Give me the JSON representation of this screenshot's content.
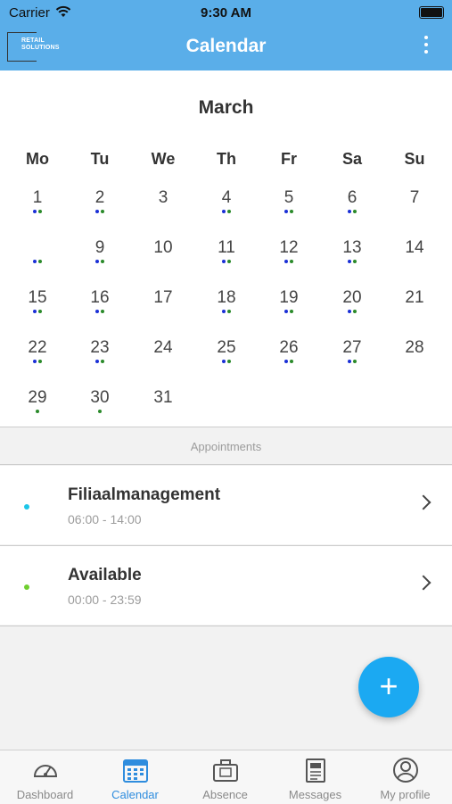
{
  "status_bar": {
    "carrier": "Carrier",
    "time": "9:30 AM"
  },
  "header": {
    "title": "Calendar",
    "logo_line1": "RETAIL",
    "logo_line2": "SOLUTIONS"
  },
  "calendar": {
    "month": "March",
    "weekdays": [
      "Mo",
      "Tu",
      "We",
      "Th",
      "Fr",
      "Sa",
      "Su"
    ],
    "days": [
      {
        "label": "1",
        "dots": [
          "blue",
          "green"
        ]
      },
      {
        "label": "2",
        "dots": [
          "blue",
          "green"
        ]
      },
      {
        "label": "3",
        "dots": []
      },
      {
        "label": "4",
        "dots": [
          "blue",
          "green"
        ]
      },
      {
        "label": "5",
        "dots": [
          "blue",
          "green"
        ]
      },
      {
        "label": "6",
        "dots": [
          "blue",
          "green"
        ]
      },
      {
        "label": "7",
        "dots": []
      },
      {
        "label": "",
        "dots": [
          "blue",
          "green"
        ]
      },
      {
        "label": "9",
        "dots": [
          "blue",
          "green"
        ]
      },
      {
        "label": "10",
        "dots": []
      },
      {
        "label": "11",
        "dots": [
          "blue",
          "green"
        ]
      },
      {
        "label": "12",
        "dots": [
          "blue",
          "green"
        ]
      },
      {
        "label": "13",
        "dots": [
          "blue",
          "green"
        ]
      },
      {
        "label": "14",
        "dots": []
      },
      {
        "label": "15",
        "dots": [
          "blue",
          "green"
        ]
      },
      {
        "label": "16",
        "dots": [
          "blue",
          "green"
        ]
      },
      {
        "label": "17",
        "dots": []
      },
      {
        "label": "18",
        "dots": [
          "blue",
          "green"
        ]
      },
      {
        "label": "19",
        "dots": [
          "blue",
          "green"
        ]
      },
      {
        "label": "20",
        "dots": [
          "blue",
          "green"
        ]
      },
      {
        "label": "21",
        "dots": []
      },
      {
        "label": "22",
        "dots": [
          "blue",
          "green"
        ]
      },
      {
        "label": "23",
        "dots": [
          "blue",
          "green"
        ]
      },
      {
        "label": "24",
        "dots": []
      },
      {
        "label": "25",
        "dots": [
          "blue",
          "green"
        ]
      },
      {
        "label": "26",
        "dots": [
          "blue",
          "green"
        ]
      },
      {
        "label": "27",
        "dots": [
          "blue",
          "green"
        ]
      },
      {
        "label": "28",
        "dots": []
      },
      {
        "label": "29",
        "dots": [
          "green"
        ]
      },
      {
        "label": "30",
        "dots": [
          "green"
        ]
      },
      {
        "label": "31",
        "dots": []
      }
    ],
    "dot_colors": {
      "blue": "#1a2fd6",
      "green": "#2a8a2a"
    }
  },
  "appointments": {
    "section_label": "Appointments",
    "items": [
      {
        "name": "Filiaalmanagement",
        "time": "06:00 - 14:00",
        "color": "#1cc6e8"
      },
      {
        "name": "Available",
        "time": "00:00 - 23:59",
        "color": "#6fcf2f"
      }
    ]
  },
  "fab": {
    "label": "+"
  },
  "tabs": [
    {
      "label": "Dashboard",
      "icon": "gauge-icon"
    },
    {
      "label": "Calendar",
      "icon": "calendar-icon",
      "active": true
    },
    {
      "label": "Absence",
      "icon": "suitcase-icon"
    },
    {
      "label": "Messages",
      "icon": "newspaper-icon"
    },
    {
      "label": "My profile",
      "icon": "user-icon"
    }
  ]
}
